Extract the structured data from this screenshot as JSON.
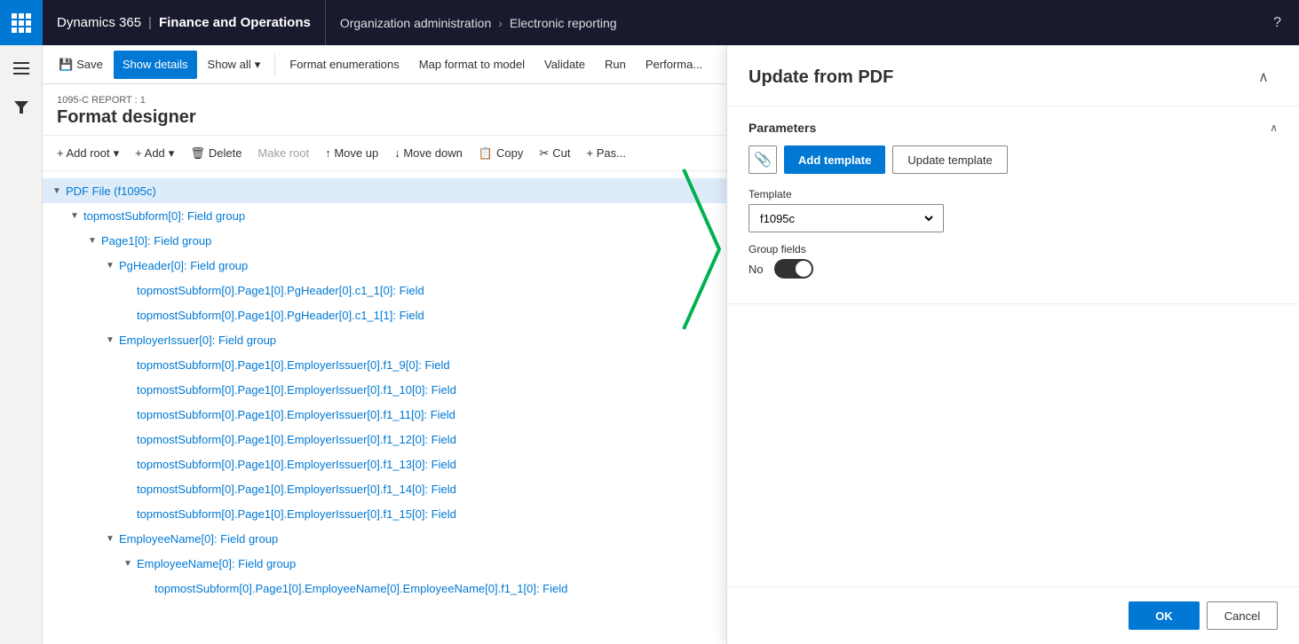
{
  "topNav": {
    "dynamics365": "Dynamics 365",
    "separator": "|",
    "financeOps": "Finance and Operations",
    "breadcrumb1": "Organization administration",
    "breadcrumbSep": ">",
    "breadcrumb2": "Electronic reporting",
    "help": "?"
  },
  "toolbar": {
    "saveLabel": "Save",
    "showDetailsLabel": "Show details",
    "showAllLabel": "Show all",
    "showAllIcon": "▾",
    "formatEnumsLabel": "Format enumerations",
    "mapFormatLabel": "Map format to model",
    "validateLabel": "Validate",
    "runLabel": "Run",
    "performaLabel": "Performa..."
  },
  "pageHeader": {
    "breadcrumb": "1095-C REPORT : 1",
    "title": "Format designer"
  },
  "actionBar": {
    "addRoot": "+ Add root",
    "addRootIcon": "▾",
    "add": "+ Add",
    "addIcon": "▾",
    "delete": "Delete",
    "makeRoot": "Make root",
    "moveUp": "↑ Move up",
    "moveDown": "↓ Move down",
    "copy": "Copy",
    "cut": "Cut",
    "paste": "+ Pas..."
  },
  "treeItems": [
    {
      "indent": 0,
      "toggle": "▼",
      "text": "PDF File (f1095c)",
      "type": "item",
      "selected": true
    },
    {
      "indent": 1,
      "toggle": "▼",
      "text": "topmostSubform[0]: Field group",
      "type": "item"
    },
    {
      "indent": 2,
      "toggle": "▼",
      "text": "Page1[0]: Field group",
      "type": "item"
    },
    {
      "indent": 3,
      "toggle": "▼",
      "text": "PgHeader[0]: Field group",
      "type": "item"
    },
    {
      "indent": 4,
      "toggle": "",
      "text": "topmostSubform[0].Page1[0].PgHeader[0].c1_1[0]: Field",
      "type": "leaf"
    },
    {
      "indent": 4,
      "toggle": "",
      "text": "topmostSubform[0].Page1[0].PgHeader[0].c1_1[1]: Field",
      "type": "leaf"
    },
    {
      "indent": 3,
      "toggle": "▼",
      "text": "EmployerIssuer[0]: Field group",
      "type": "item"
    },
    {
      "indent": 4,
      "toggle": "",
      "text": "topmostSubform[0].Page1[0].EmployerIssuer[0].f1_9[0]: Field",
      "type": "leaf"
    },
    {
      "indent": 4,
      "toggle": "",
      "text": "topmostSubform[0].Page1[0].EmployerIssuer[0].f1_10[0]: Field",
      "type": "leaf"
    },
    {
      "indent": 4,
      "toggle": "",
      "text": "topmostSubform[0].Page1[0].EmployerIssuer[0].f1_11[0]: Field",
      "type": "leaf"
    },
    {
      "indent": 4,
      "toggle": "",
      "text": "topmostSubform[0].Page1[0].EmployerIssuer[0].f1_12[0]: Field",
      "type": "leaf"
    },
    {
      "indent": 4,
      "toggle": "",
      "text": "topmostSubform[0].Page1[0].EmployerIssuer[0].f1_13[0]: Field",
      "type": "leaf"
    },
    {
      "indent": 4,
      "toggle": "",
      "text": "topmostSubform[0].Page1[0].EmployerIssuer[0].f1_14[0]: Field",
      "type": "leaf"
    },
    {
      "indent": 4,
      "toggle": "",
      "text": "topmostSubform[0].Page1[0].EmployerIssuer[0].f1_15[0]: Field",
      "type": "leaf"
    },
    {
      "indent": 3,
      "toggle": "▼",
      "text": "EmployeeName[0]: Field group",
      "type": "item"
    },
    {
      "indent": 4,
      "toggle": "▼",
      "text": "EmployeeName[0]: Field group",
      "type": "item"
    },
    {
      "indent": 5,
      "toggle": "",
      "text": "topmostSubform[0].Page1[0].EmployeeName[0].EmployeeName[0].f1_1[0]: Field",
      "type": "leaf"
    }
  ],
  "dialog": {
    "title": "Update from PDF",
    "sectionTitle": "Parameters",
    "attachIcon": "📎",
    "addTemplateLabel": "Add template",
    "updateTemplateLabel": "Update template",
    "templateLabel": "Template",
    "templateValue": "f1095c",
    "groupFieldsLabel": "Group fields",
    "groupFieldsToggleLabel": "No",
    "okLabel": "OK",
    "cancelLabel": "Cancel"
  }
}
